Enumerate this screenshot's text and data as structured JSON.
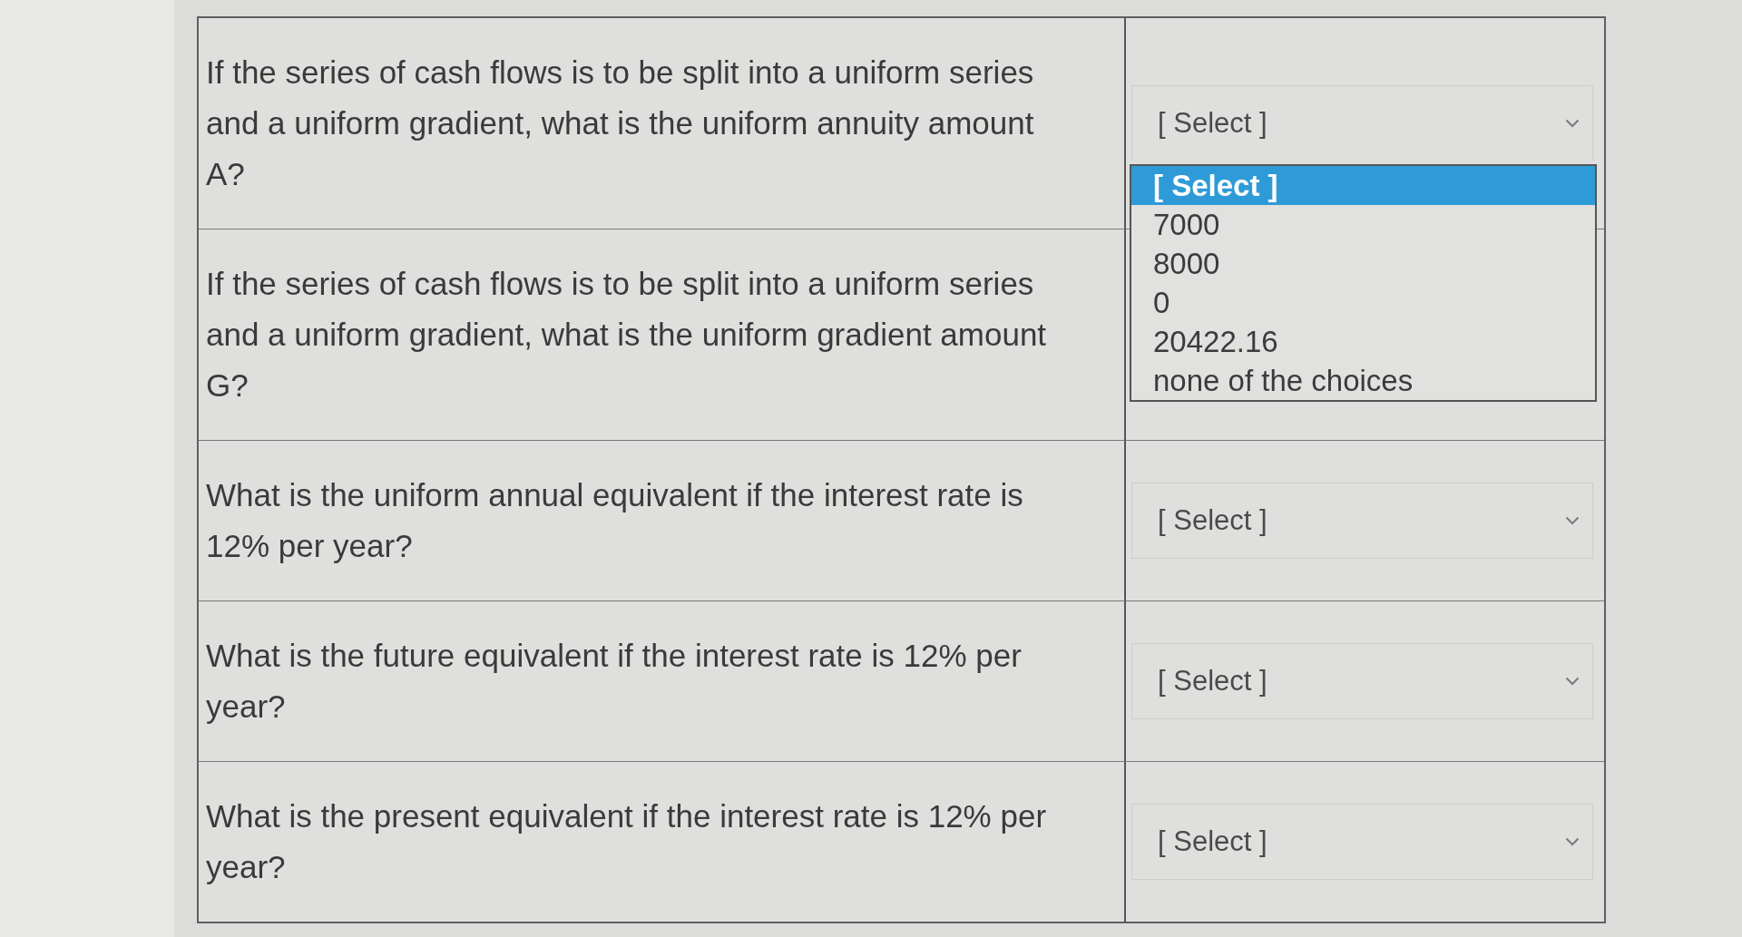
{
  "questions": [
    {
      "text": "If the series of cash flows is to be split into a uniform series and a uniform gradient, what is the uniform annuity amount A?",
      "dropdown": {
        "value": "[ Select ]",
        "expanded": true,
        "options": [
          {
            "label": "[ Select ]",
            "selected": true
          },
          {
            "label": "7000",
            "selected": false
          },
          {
            "label": "8000",
            "selected": false
          },
          {
            "label": "0",
            "selected": false
          },
          {
            "label": "20422.16",
            "selected": false
          },
          {
            "label": "none of the choices",
            "selected": false
          }
        ]
      }
    },
    {
      "text": "If the series of cash flows is to be split into a uniform series and a uniform gradient, what is the uniform gradient amount G?"
    },
    {
      "text": "What is the uniform annual equivalent if the interest rate is 12% per year?",
      "dropdown": {
        "value": "[ Select ]",
        "expanded": false
      }
    },
    {
      "text": "What is the future equivalent if the interest rate is 12% per year?",
      "dropdown": {
        "value": "[ Select ]",
        "expanded": false
      }
    },
    {
      "text": "What is the present equivalent if the interest rate is 12% per year?",
      "dropdown": {
        "value": "[ Select ]",
        "expanded": false
      }
    }
  ]
}
